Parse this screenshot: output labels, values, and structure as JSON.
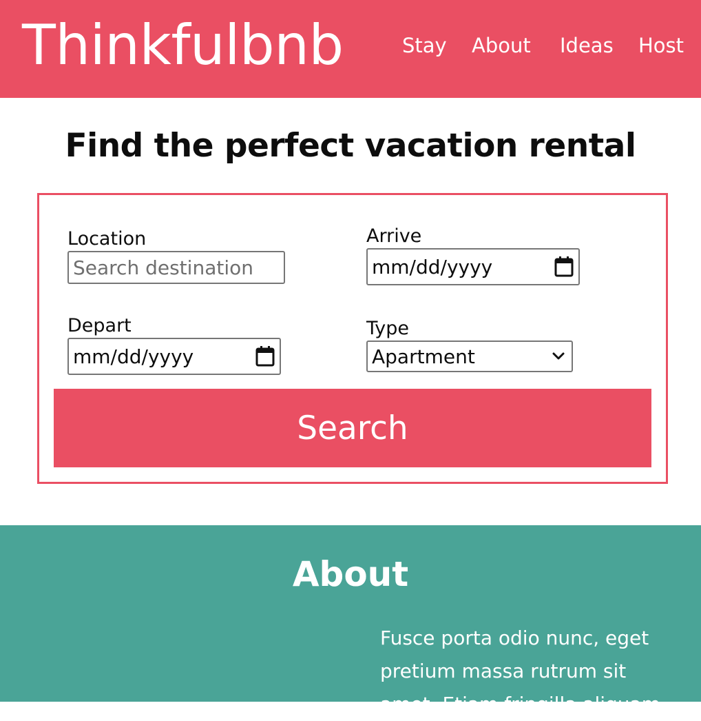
{
  "colors": {
    "brand": "#ea4f63",
    "about_bg": "#4aa497",
    "text": "#0d0d0d"
  },
  "header": {
    "brand": "Thinkfulbnb",
    "nav": [
      "Stay",
      "About",
      "Ideas",
      "Host"
    ]
  },
  "hero": {
    "title": "Find the perfect vacation rental"
  },
  "form": {
    "location": {
      "label": "Location",
      "placeholder": "Search destination",
      "icon": "none"
    },
    "arrive": {
      "label": "Arrive",
      "value": "mm/dd/yyyy",
      "icon": "calendar-icon"
    },
    "depart": {
      "label": "Depart",
      "value": "mm/dd/yyyy",
      "icon": "calendar-icon"
    },
    "type": {
      "label": "Type",
      "selected": "Apartment",
      "icon": "chevron-down-icon"
    },
    "search_label": "Search"
  },
  "about": {
    "title": "About",
    "text": "Fusce porta odio nunc, eget pretium massa rutrum sit amet. Etiam fringilla aliquam"
  }
}
